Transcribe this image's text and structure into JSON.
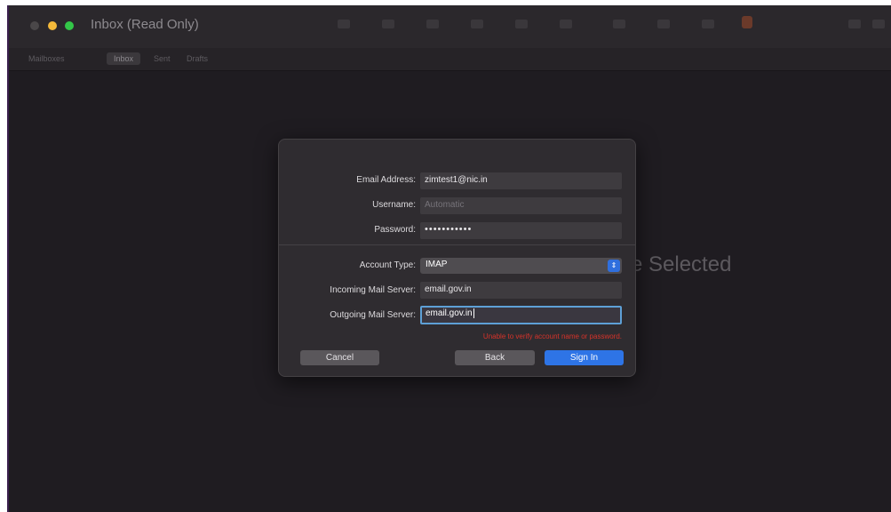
{
  "window": {
    "title": "Inbox (Read Only)"
  },
  "favorites": {
    "mailboxes": "Mailboxes",
    "inbox": "Inbox",
    "sent": "Sent",
    "drafts": "Drafts"
  },
  "content": {
    "no_message_text": "e Selected"
  },
  "dialog": {
    "email_label": "Email Address:",
    "email_value": "zimtest1@nic.in",
    "username_label": "Username:",
    "username_placeholder": "Automatic",
    "password_label": "Password:",
    "password_value": "•••••••••••",
    "account_type_label": "Account Type:",
    "account_type_value": "IMAP",
    "incoming_label": "Incoming Mail Server:",
    "incoming_value": "email.gov.in",
    "outgoing_label": "Outgoing Mail Server:",
    "outgoing_value": "email.gov.in",
    "error_message": "Unable to verify account name or password.",
    "cancel_label": "Cancel",
    "back_label": "Back",
    "signin_label": "Sign In"
  },
  "colors": {
    "accent": "#2e74e6",
    "error": "#d6332a",
    "focus_ring": "#5ea0d6"
  }
}
